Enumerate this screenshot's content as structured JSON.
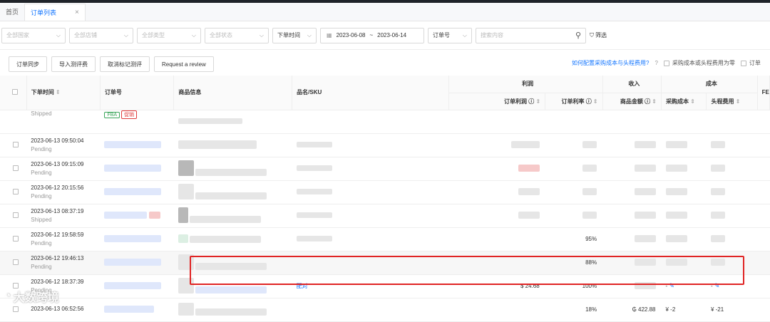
{
  "tabs": [
    {
      "label": "首页"
    },
    {
      "label": "订单列表",
      "close": "×"
    }
  ],
  "filters": {
    "country": "全部国家",
    "store": "全部店铺",
    "type": "全部类型",
    "status": "全部状态",
    "time_field": "下单时间",
    "date_start": "2023-06-08",
    "date_sep": "~",
    "date_end": "2023-06-14",
    "search_field": "订单号",
    "search_placeholder": "搜索内容",
    "filter_label": "筛选"
  },
  "actions": {
    "sync": "订单同步",
    "import": "导入测评费",
    "unmark": "取消标记测评",
    "review": "Request a review",
    "config_link": "如何配置采购成本与头程费用?",
    "zero_label": "采购成本或头程费用为零",
    "order_label": "订单"
  },
  "headers": {
    "order_time": "下单时间",
    "order_no": "订单号",
    "product": "商品信息",
    "sku": "品名/SKU",
    "profit_group": "利润",
    "revenue_group": "收入",
    "cost_group": "成本",
    "order_profit": "订单利润",
    "profit_rate": "订单利率",
    "product_amount": "商品金额",
    "purchase_cost": "采购成本",
    "first_leg": "头程费用",
    "fba_col": "FE"
  },
  "rows": [
    {
      "time": "",
      "status": "Shipped",
      "tags": [
        "FBA",
        "促销"
      ],
      "sku": "",
      "profit": "",
      "rate": "",
      "amount": "",
      "cost": "",
      "freight": ""
    },
    {
      "time": "2023-06-13 09:50:04",
      "status": "Pending",
      "tags": [],
      "sku": "",
      "profit": "",
      "rate": "",
      "amount": "",
      "cost": "",
      "freight": ""
    },
    {
      "time": "2023-06-13 09:15:09",
      "status": "Pending",
      "tags": [],
      "sku": "",
      "profit": "",
      "rate": "",
      "amount": "",
      "cost": "",
      "freight": ""
    },
    {
      "time": "2023-06-12 20:15:56",
      "status": "Pending",
      "tags": [],
      "sku": "",
      "profit": "",
      "rate": "",
      "amount": "",
      "cost": "",
      "freight": ""
    },
    {
      "time": "2023-06-13 08:37:19",
      "status": "Shipped",
      "tags": [],
      "sku": "",
      "profit": "",
      "rate": "",
      "amount": "",
      "cost": "",
      "freight": ""
    },
    {
      "time": "2023-06-12 19:58:59",
      "status": "Pending",
      "tags": [],
      "sku": "",
      "profit": "",
      "rate": "95%",
      "amount": "",
      "cost": "",
      "freight": ""
    },
    {
      "time": "2023-06-12 19:46:13",
      "status": "Pending",
      "tags": [],
      "sku": "",
      "profit": "",
      "rate": "88%",
      "amount": "",
      "cost": "",
      "freight": ""
    },
    {
      "time": "2023-06-12 18:37:39",
      "status": "Pending",
      "tags": [],
      "sku": "配对",
      "profit": "$ 24.68",
      "rate": "100%",
      "amount": "",
      "cost": "-",
      "freight": "-"
    },
    {
      "time": "2023-06-13 06:52:56",
      "status": "",
      "tags": [],
      "sku": "",
      "profit": "",
      "rate": "18%",
      "amount": "₲ 422.88",
      "cost": "¥ -2",
      "freight": "¥ -21"
    }
  ],
  "watermark": "大数跨境"
}
